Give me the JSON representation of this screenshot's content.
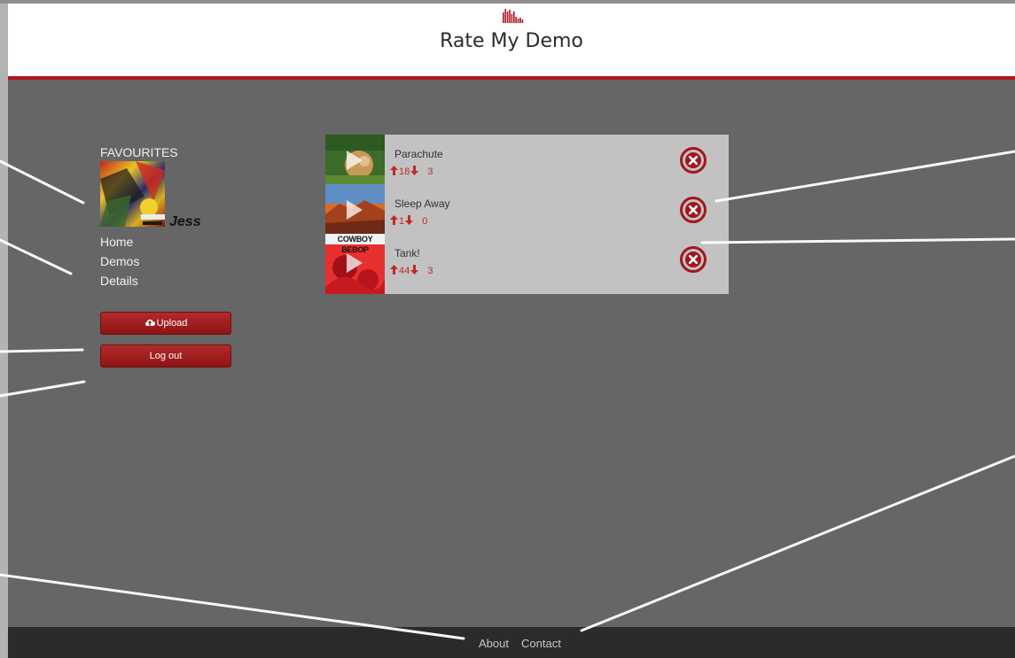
{
  "header": {
    "title": "Rate My Demo"
  },
  "sidebar": {
    "heading": "FAVOURITES",
    "username": "Jess",
    "nav": [
      "Home",
      "Demos",
      "Details"
    ],
    "upload_label": "Upload",
    "logout_label": "Log out"
  },
  "demos": [
    {
      "title": "Parachute",
      "upvotes": "18",
      "downvotes": "3"
    },
    {
      "title": "Sleep Away",
      "upvotes": "1",
      "downvotes": "0"
    },
    {
      "title": "Tank!",
      "upvotes": "44",
      "downvotes": "3",
      "cover_text": "COWBOY BEBOP"
    }
  ],
  "footer": {
    "about": "About",
    "contact": "Contact"
  },
  "colors": {
    "accent": "#b3141c",
    "background": "#666666",
    "panel": "#c2c2c2",
    "footer": "#2b2b2b"
  },
  "icons": {
    "logo": "equalizer-bars-icon",
    "upload": "cloud-upload-icon",
    "up": "arrow-up-icon",
    "down": "arrow-down-icon",
    "remove": "close-circle-icon",
    "play": "play-icon"
  }
}
